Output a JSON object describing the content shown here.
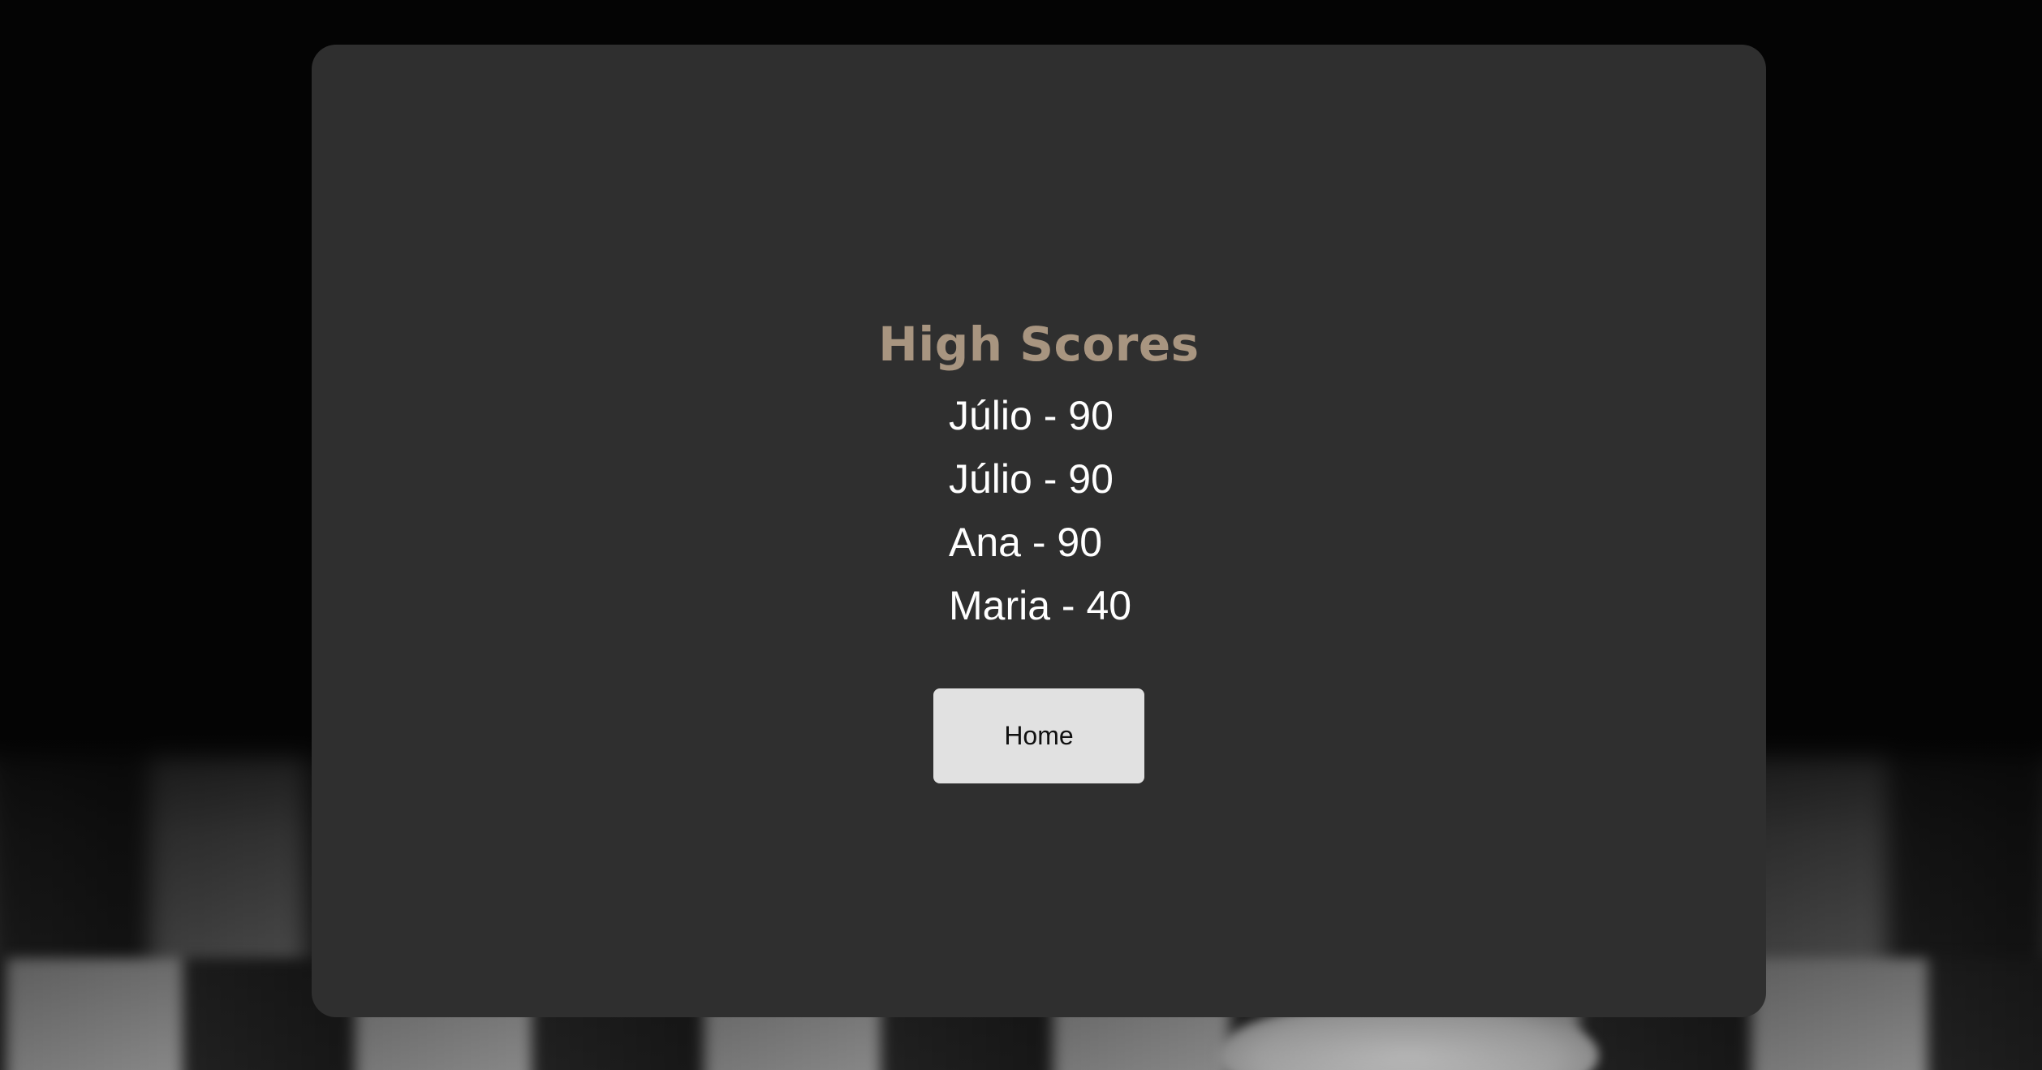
{
  "high_scores": {
    "title": "High Scores",
    "entries": [
      {
        "text": "Júlio - 90"
      },
      {
        "text": "Júlio - 90"
      },
      {
        "text": "Ana - 90"
      },
      {
        "text": "Maria - 40"
      }
    ],
    "home_label": "Home"
  },
  "colors": {
    "title": "#a89580",
    "card_background": "#2f2f2f",
    "button_background": "#e1e1e1",
    "page_background": "#040404"
  }
}
